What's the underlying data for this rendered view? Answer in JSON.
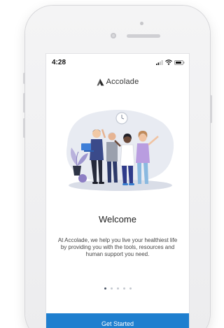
{
  "status_bar": {
    "time": "4:28",
    "icons": [
      "signal-icon",
      "wifi-icon",
      "battery-icon"
    ]
  },
  "brand": {
    "name": "Accolade",
    "logo_icon": "accolade-logo-icon",
    "accent_color": "#1f7fcf"
  },
  "onboarding": {
    "illustration": "group-of-people-celebrating",
    "title": "Welcome",
    "body": "At Accolade, we help you live your healthiest life by providing you with the tools, resources and human support you need.",
    "pager": {
      "total": 5,
      "current": 1
    },
    "cta_label": "Get Started"
  }
}
